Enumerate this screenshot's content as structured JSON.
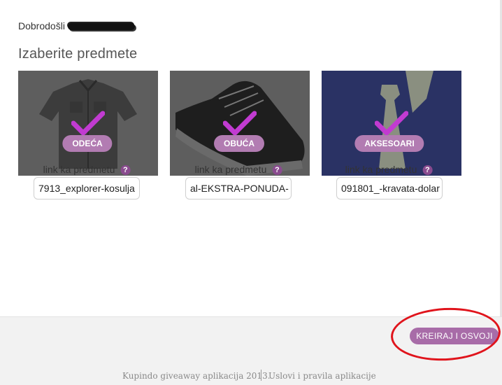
{
  "header": {
    "welcome_label": "Dobrodošli",
    "heading": "Izaberite predmete"
  },
  "items": [
    {
      "category": "ODEĆA",
      "link_label": "link ka predmetu",
      "help": "?",
      "link_value": "7913_explorer-kosulja",
      "image": "shirt",
      "selected": true
    },
    {
      "category": "OBUĆA",
      "link_label": "link ka predmetu",
      "help": "?",
      "link_value": "al-EKSTRA-PONUDA-",
      "image": "shoe",
      "selected": true
    },
    {
      "category": "AKSESOARI",
      "link_label": "link ka predmetu",
      "help": "?",
      "link_value": "091801_-kravata-dolar",
      "image": "tie",
      "selected": true
    }
  ],
  "actions": {
    "create_label": "KREIRAJ I OSVOJI"
  },
  "footer": {
    "copyright": "Kupindo giveaway aplikacija 2013.",
    "terms_link": "Uslovi i pravila aplikacije"
  },
  "colors": {
    "accent": "#b27cb2",
    "check": "#c13bd1",
    "annotation": "#e0141c"
  }
}
